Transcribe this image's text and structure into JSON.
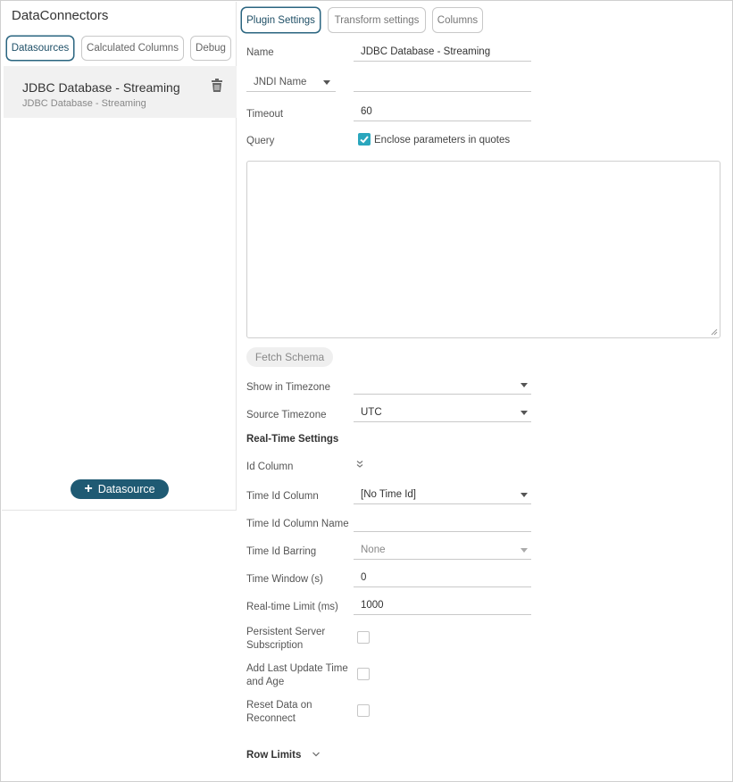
{
  "left_panel": {
    "title": "DataConnectors",
    "tabs": [
      {
        "label": "Datasources"
      },
      {
        "label": "Calculated Columns"
      },
      {
        "label": "Debug"
      }
    ],
    "datasource": {
      "name": "JDBC Database - Streaming",
      "type": "JDBC Database - Streaming"
    },
    "add_button": "Datasource"
  },
  "right_panel": {
    "tabs": [
      {
        "label": "Plugin Settings"
      },
      {
        "label": "Transform settings"
      },
      {
        "label": "Columns"
      }
    ],
    "name_label": "Name",
    "name_value": "JDBC Database - Streaming",
    "jndi_label": "JNDI Name",
    "jndi_value": "",
    "timeout_label": "Timeout",
    "timeout_value": "60",
    "query_label": "Query",
    "enclose_label": "Enclose parameters in quotes",
    "enclose_checked": true,
    "query_text": "",
    "fetch_schema": "Fetch Schema",
    "show_tz_label": "Show in Timezone",
    "show_tz_value": "",
    "source_tz_label": "Source Timezone",
    "source_tz_value": "UTC",
    "realtime_heading": "Real-Time Settings",
    "id_column_label": "Id Column",
    "time_id_column_label": "Time Id Column",
    "time_id_column_value": "[No Time Id]",
    "time_id_column_name_label": "Time Id Column Name",
    "time_id_column_name_value": "",
    "time_id_barring_label": "Time Id Barring",
    "time_id_barring_value": "None",
    "time_window_label": "Time Window (s)",
    "time_window_value": "0",
    "realtime_limit_label": "Real-time Limit (ms)",
    "realtime_limit_value": "1000",
    "persistent_label_1": "Persistent Server",
    "persistent_label_2": "Subscription",
    "add_last_label_1": "Add Last Update Time",
    "add_last_label_2": "and Age",
    "reset_label_1": "Reset Data on",
    "reset_label_2": "Reconnect",
    "row_limits": "Row Limits"
  },
  "colors": {
    "accent": "#1f5a73",
    "checkbox": "#2aa6bd"
  }
}
